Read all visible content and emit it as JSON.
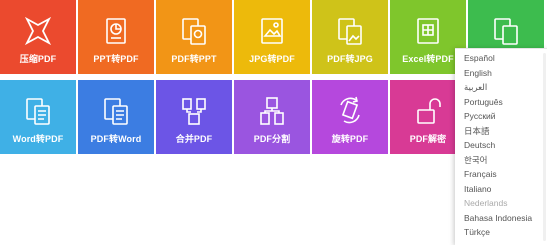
{
  "tools_row1": [
    {
      "label": "压缩PDF",
      "icon": "compress-icon",
      "color": "#eb4a2e"
    },
    {
      "label": "PPT转PDF",
      "icon": "ppt-to-pdf-icon",
      "color": "#f06a22"
    },
    {
      "label": "PDF转PPT",
      "icon": "pdf-to-ppt-icon",
      "color": "#f29516"
    },
    {
      "label": "JPG转PDF",
      "icon": "jpg-to-pdf-icon",
      "color": "#edba0b"
    },
    {
      "label": "PDF转JPG",
      "icon": "pdf-to-jpg-icon",
      "color": "#cfc319"
    },
    {
      "label": "Excel转PDF",
      "icon": "excel-to-pdf-icon",
      "color": "#7fc62c"
    },
    {
      "label": "",
      "icon": "pdf-to-excel-icon",
      "color": "#3dbc4e"
    }
  ],
  "tools_row2": [
    {
      "label": "Word转PDF",
      "icon": "word-to-pdf-icon",
      "color": "#3fb0e6"
    },
    {
      "label": "PDF转Word",
      "icon": "pdf-to-word-icon",
      "color": "#3c7de2"
    },
    {
      "label": "合并PDF",
      "icon": "merge-pdf-icon",
      "color": "#6c55e6"
    },
    {
      "label": "PDF分割",
      "icon": "split-pdf-icon",
      "color": "#9a55e0"
    },
    {
      "label": "旋转PDF",
      "icon": "rotate-pdf-icon",
      "color": "#b548dd"
    },
    {
      "label": "PDF解密",
      "icon": "unlock-pdf-icon",
      "color": "#d83a95"
    }
  ],
  "languages": [
    "Español",
    "English",
    "العربية",
    "Português",
    "Pусский",
    "日本語",
    "Deutsch",
    "한국어",
    "Français",
    "Italiano",
    "Nederlands",
    "Bahasa Indonesia",
    "Türkçe"
  ]
}
